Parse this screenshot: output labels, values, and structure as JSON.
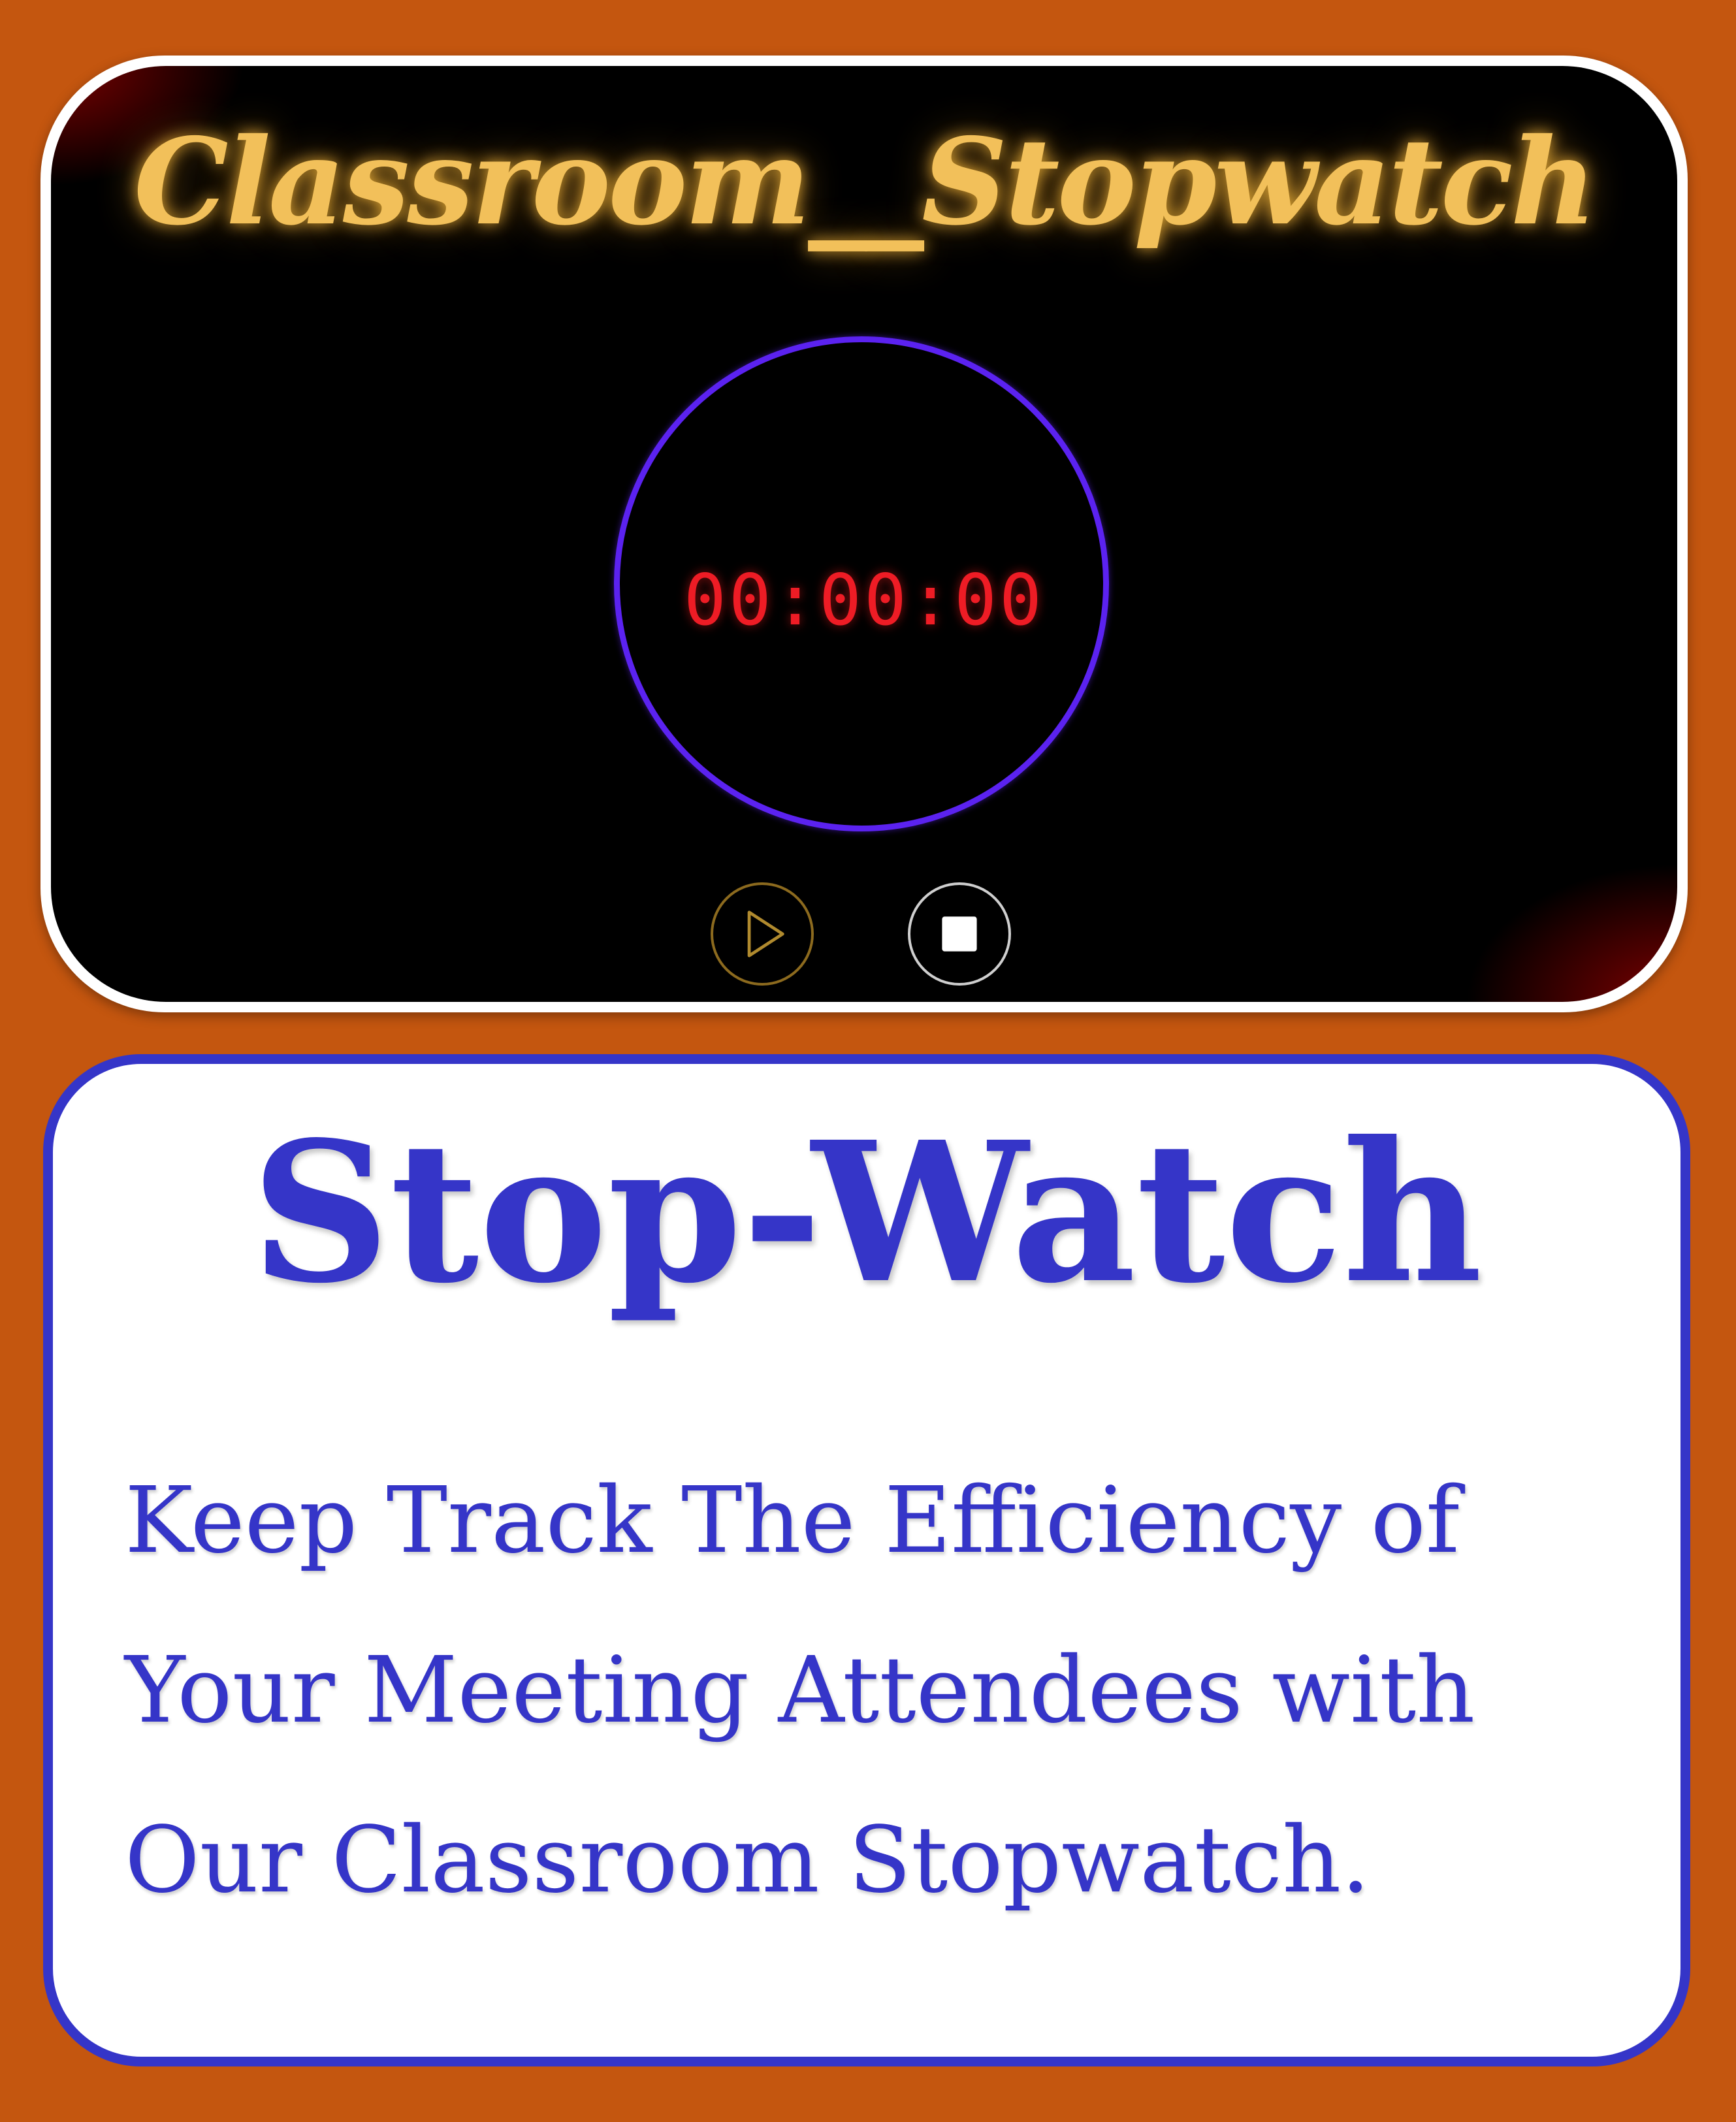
{
  "app": {
    "title": "Classroom__Stopwatch",
    "time": "00:00:00",
    "controls": {
      "play": {
        "icon": "play-icon"
      },
      "stop": {
        "icon": "stop-icon"
      }
    },
    "colors": {
      "title": "#f2c05a",
      "ring": "#5b22f0",
      "time": "#ee1c25"
    }
  },
  "card": {
    "title": "Stop-Watch",
    "lines": [
      "Keep Track The Efficiency of",
      "Your Meeting Attendees with",
      "Our Classroom Stopwatch."
    ],
    "colors": {
      "text": "#3535c8",
      "background": "#ffffff"
    }
  },
  "page": {
    "background": "#c4560f"
  }
}
